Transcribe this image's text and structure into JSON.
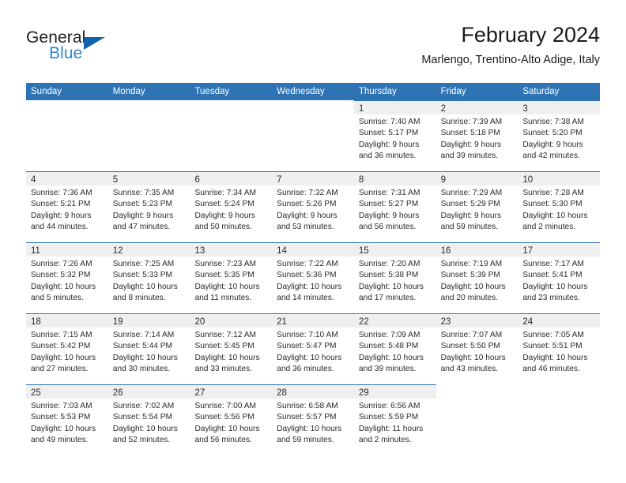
{
  "brand": {
    "name_top": "General",
    "name_bottom": "Blue",
    "top_color": "#231f20",
    "bottom_color": "#2d85d0",
    "triangle_color": "#1263ae",
    "triangle_icon": "triangle-right-icon"
  },
  "header": {
    "title": "February 2024",
    "subtitle": "Marlengo, Trentino-Alto Adige, Italy"
  },
  "theme": {
    "header_bar_color": "#2e74b5",
    "day_band_color": "#efefef",
    "row_rule_color": "#2e74b5",
    "text_color": "#2b2b2b"
  },
  "calendar": {
    "weekdays": [
      "Sunday",
      "Monday",
      "Tuesday",
      "Wednesday",
      "Thursday",
      "Friday",
      "Saturday"
    ],
    "weeks": [
      [
        {
          "day": "",
          "lines": []
        },
        {
          "day": "",
          "lines": []
        },
        {
          "day": "",
          "lines": []
        },
        {
          "day": "",
          "lines": []
        },
        {
          "day": "1",
          "lines": [
            "Sunrise: 7:40 AM",
            "Sunset: 5:17 PM",
            "Daylight: 9 hours",
            "and 36 minutes."
          ]
        },
        {
          "day": "2",
          "lines": [
            "Sunrise: 7:39 AM",
            "Sunset: 5:18 PM",
            "Daylight: 9 hours",
            "and 39 minutes."
          ]
        },
        {
          "day": "3",
          "lines": [
            "Sunrise: 7:38 AM",
            "Sunset: 5:20 PM",
            "Daylight: 9 hours",
            "and 42 minutes."
          ]
        }
      ],
      [
        {
          "day": "4",
          "lines": [
            "Sunrise: 7:36 AM",
            "Sunset: 5:21 PM",
            "Daylight: 9 hours",
            "and 44 minutes."
          ]
        },
        {
          "day": "5",
          "lines": [
            "Sunrise: 7:35 AM",
            "Sunset: 5:23 PM",
            "Daylight: 9 hours",
            "and 47 minutes."
          ]
        },
        {
          "day": "6",
          "lines": [
            "Sunrise: 7:34 AM",
            "Sunset: 5:24 PM",
            "Daylight: 9 hours",
            "and 50 minutes."
          ]
        },
        {
          "day": "7",
          "lines": [
            "Sunrise: 7:32 AM",
            "Sunset: 5:26 PM",
            "Daylight: 9 hours",
            "and 53 minutes."
          ]
        },
        {
          "day": "8",
          "lines": [
            "Sunrise: 7:31 AM",
            "Sunset: 5:27 PM",
            "Daylight: 9 hours",
            "and 56 minutes."
          ]
        },
        {
          "day": "9",
          "lines": [
            "Sunrise: 7:29 AM",
            "Sunset: 5:29 PM",
            "Daylight: 9 hours",
            "and 59 minutes."
          ]
        },
        {
          "day": "10",
          "lines": [
            "Sunrise: 7:28 AM",
            "Sunset: 5:30 PM",
            "Daylight: 10 hours",
            "and 2 minutes."
          ]
        }
      ],
      [
        {
          "day": "11",
          "lines": [
            "Sunrise: 7:26 AM",
            "Sunset: 5:32 PM",
            "Daylight: 10 hours",
            "and 5 minutes."
          ]
        },
        {
          "day": "12",
          "lines": [
            "Sunrise: 7:25 AM",
            "Sunset: 5:33 PM",
            "Daylight: 10 hours",
            "and 8 minutes."
          ]
        },
        {
          "day": "13",
          "lines": [
            "Sunrise: 7:23 AM",
            "Sunset: 5:35 PM",
            "Daylight: 10 hours",
            "and 11 minutes."
          ]
        },
        {
          "day": "14",
          "lines": [
            "Sunrise: 7:22 AM",
            "Sunset: 5:36 PM",
            "Daylight: 10 hours",
            "and 14 minutes."
          ]
        },
        {
          "day": "15",
          "lines": [
            "Sunrise: 7:20 AM",
            "Sunset: 5:38 PM",
            "Daylight: 10 hours",
            "and 17 minutes."
          ]
        },
        {
          "day": "16",
          "lines": [
            "Sunrise: 7:19 AM",
            "Sunset: 5:39 PM",
            "Daylight: 10 hours",
            "and 20 minutes."
          ]
        },
        {
          "day": "17",
          "lines": [
            "Sunrise: 7:17 AM",
            "Sunset: 5:41 PM",
            "Daylight: 10 hours",
            "and 23 minutes."
          ]
        }
      ],
      [
        {
          "day": "18",
          "lines": [
            "Sunrise: 7:15 AM",
            "Sunset: 5:42 PM",
            "Daylight: 10 hours",
            "and 27 minutes."
          ]
        },
        {
          "day": "19",
          "lines": [
            "Sunrise: 7:14 AM",
            "Sunset: 5:44 PM",
            "Daylight: 10 hours",
            "and 30 minutes."
          ]
        },
        {
          "day": "20",
          "lines": [
            "Sunrise: 7:12 AM",
            "Sunset: 5:45 PM",
            "Daylight: 10 hours",
            "and 33 minutes."
          ]
        },
        {
          "day": "21",
          "lines": [
            "Sunrise: 7:10 AM",
            "Sunset: 5:47 PM",
            "Daylight: 10 hours",
            "and 36 minutes."
          ]
        },
        {
          "day": "22",
          "lines": [
            "Sunrise: 7:09 AM",
            "Sunset: 5:48 PM",
            "Daylight: 10 hours",
            "and 39 minutes."
          ]
        },
        {
          "day": "23",
          "lines": [
            "Sunrise: 7:07 AM",
            "Sunset: 5:50 PM",
            "Daylight: 10 hours",
            "and 43 minutes."
          ]
        },
        {
          "day": "24",
          "lines": [
            "Sunrise: 7:05 AM",
            "Sunset: 5:51 PM",
            "Daylight: 10 hours",
            "and 46 minutes."
          ]
        }
      ],
      [
        {
          "day": "25",
          "lines": [
            "Sunrise: 7:03 AM",
            "Sunset: 5:53 PM",
            "Daylight: 10 hours",
            "and 49 minutes."
          ]
        },
        {
          "day": "26",
          "lines": [
            "Sunrise: 7:02 AM",
            "Sunset: 5:54 PM",
            "Daylight: 10 hours",
            "and 52 minutes."
          ]
        },
        {
          "day": "27",
          "lines": [
            "Sunrise: 7:00 AM",
            "Sunset: 5:56 PM",
            "Daylight: 10 hours",
            "and 56 minutes."
          ]
        },
        {
          "day": "28",
          "lines": [
            "Sunrise: 6:58 AM",
            "Sunset: 5:57 PM",
            "Daylight: 10 hours",
            "and 59 minutes."
          ]
        },
        {
          "day": "29",
          "lines": [
            "Sunrise: 6:56 AM",
            "Sunset: 5:59 PM",
            "Daylight: 11 hours",
            "and 2 minutes."
          ]
        },
        {
          "day": "",
          "lines": []
        },
        {
          "day": "",
          "lines": []
        }
      ]
    ]
  }
}
